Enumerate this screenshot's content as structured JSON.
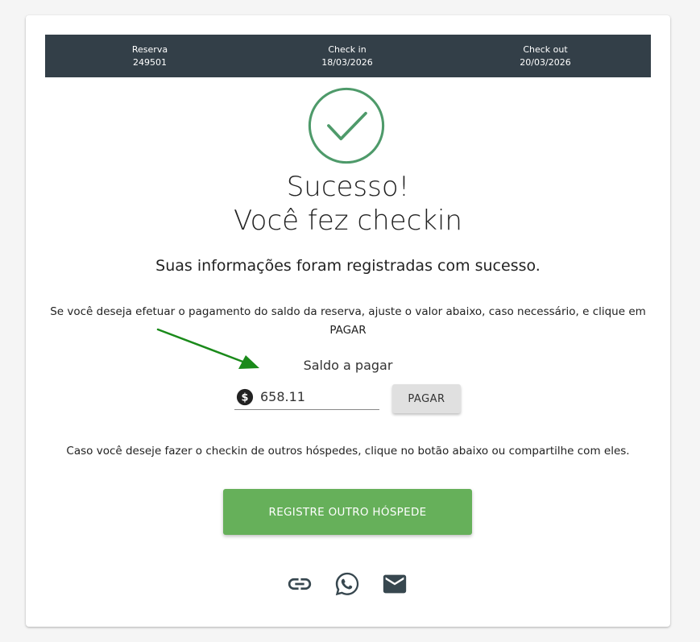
{
  "reservation_bar": {
    "reserva_label": "Reserva",
    "reserva_value": "249501",
    "checkin_label": "Check in",
    "checkin_value": "18/03/2026",
    "checkout_label": "Check out",
    "checkout_value": "20/03/2026"
  },
  "success": {
    "title_line1": "Sucesso!",
    "title_line2": "Você fez checkin",
    "subtitle": "Suas informações foram registradas com sucesso."
  },
  "payment": {
    "instructions": "Se você deseja efetuar o pagamento do saldo da reserva, ajuste o valor abaixo, caso necessário, e clique em PAGAR",
    "saldo_label": "Saldo a pagar",
    "amount_value": "658.11",
    "pay_button": "PAGAR"
  },
  "other_guests": {
    "text": "Caso você deseje fazer o checkin de outros hóspedes, clique no botão abaixo ou compartilhe com eles.",
    "register_button": "REGISTRE OUTRO HÓSPEDE"
  },
  "share_icons": [
    "link-icon",
    "whatsapp-icon",
    "email-icon"
  ],
  "colors": {
    "header_bar": "#333f48",
    "success_green": "#4e9a6a",
    "register_button": "#66b05a",
    "arrow_green": "#1a8a1a",
    "icon_dark": "#37474f"
  }
}
